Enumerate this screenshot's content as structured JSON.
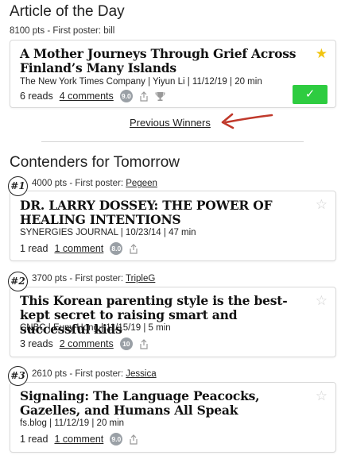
{
  "article_of_day": {
    "heading": "Article of the Day",
    "meta_prefix": "8100 pts - First poster: ",
    "poster": "bill",
    "title": "A Mother Journeys Through Grief Across Finland’s Many Islands",
    "source": "The New York Times Company | Yiyun Li | 11/12/19 | 20 min",
    "reads": "6 reads",
    "comments": "4 comments",
    "score": "9.0",
    "check": "✓",
    "star": "★"
  },
  "previous_winners": "Previous Winners",
  "contenders": {
    "heading": "Contenders for Tomorrow",
    "items": [
      {
        "rank": "#1",
        "meta_prefix": "4000 pts - First poster: ",
        "poster": "Pegeen",
        "title": "DR. LARRY DOSSEY: THE POWER OF HEALING INTENTIONS",
        "source": "SYNERGIES JOURNAL | 10/23/14 | 47 min",
        "reads": "1 read",
        "comments": "1 comment",
        "score": "8.0"
      },
      {
        "rank": "#2",
        "meta_prefix": "3700 pts - First poster: ",
        "poster": "TripleG",
        "title": "This Korean parenting style is the best-kept secret to raising smart and successful kids",
        "source": "CNBC | Euny Hong | 11/15/19 | 5 min",
        "reads": "3 reads",
        "comments": "2 comments",
        "score": "10"
      },
      {
        "rank": "#3",
        "meta_prefix": "2610 pts - First poster: ",
        "poster": "Jessica",
        "title": "Signaling: The Language Peacocks, Gazelles, and Humans All Speak",
        "source": "fs.blog | 11/12/19 | 20 min",
        "reads": "1 read",
        "comments": "1 comment",
        "score": "9.0"
      }
    ]
  },
  "icons": {
    "share": "share-icon",
    "trophy": "trophy-icon",
    "star_empty": "☆"
  },
  "colors": {
    "accent_green": "#2ecc40",
    "star_gold": "#f1c40f",
    "arrow_red": "#c0392b",
    "score_gray": "#9aa0a6"
  }
}
